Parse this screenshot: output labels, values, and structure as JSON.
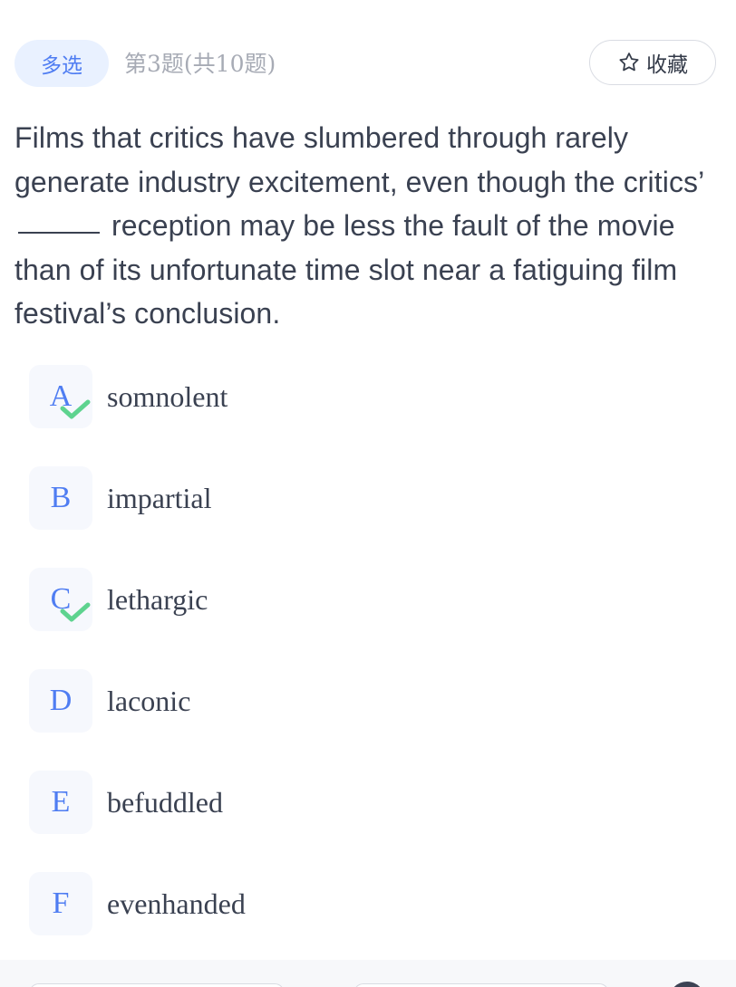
{
  "header": {
    "type_label": "多选",
    "progress_label": "第3题(共10题)",
    "favorite_label": "收藏"
  },
  "question": {
    "before_blank": "Films that critics have slumbered through rarely generate industry excitement, even though the critics’ ",
    "after_blank": " reception may be less the fault of the movie than of its unfortunate time slot near a fatiguing film festival’s conclusion."
  },
  "options": [
    {
      "letter": "A",
      "text": "somnolent",
      "selected": true
    },
    {
      "letter": "B",
      "text": "impartial",
      "selected": false
    },
    {
      "letter": "C",
      "text": "lethargic",
      "selected": true
    },
    {
      "letter": "D",
      "text": "laconic",
      "selected": false
    },
    {
      "letter": "E",
      "text": "befuddled",
      "selected": false
    },
    {
      "letter": "F",
      "text": "evenhanded",
      "selected": false
    }
  ],
  "colors": {
    "accent": "#4f7df2",
    "badge_bg": "#e9f1ff",
    "check": "#5ed38f",
    "text": "#3a4151",
    "muted": "#a7abb5"
  },
  "icons": {
    "favorite": "star-outline-icon",
    "selected": "check-icon"
  }
}
